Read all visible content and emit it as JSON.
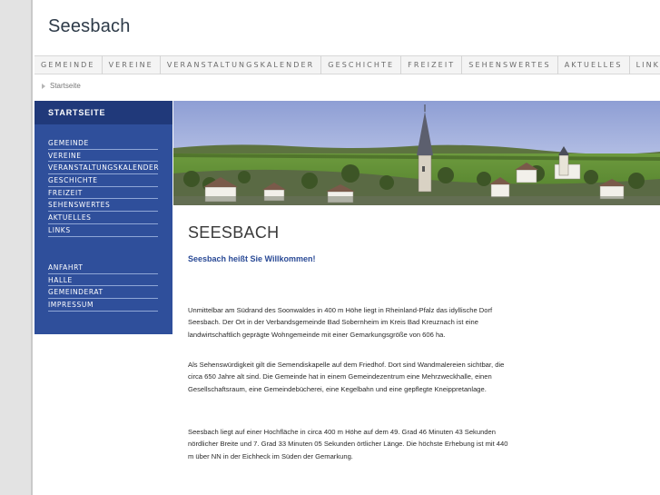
{
  "site": {
    "title": "Seesbach"
  },
  "topnav": {
    "items": [
      "GEMEINDE",
      "VEREINE",
      "VERANSTALTUNGSKALENDER",
      "GESCHICHTE",
      "FREIZEIT",
      "SEHENSWERTES",
      "AKTUELLES",
      "LINKS"
    ]
  },
  "breadcrumb": {
    "current": "Startseite"
  },
  "sidebar": {
    "heading": "STARTSEITE",
    "items": [
      "GEMEINDE",
      "VEREINE",
      "VERANSTALTUNGSKALENDER",
      "GESCHICHTE",
      "FREIZEIT",
      "SEHENSWERTES",
      "AKTUELLES",
      "LINKS"
    ],
    "items2": [
      "ANFAHRT",
      "HALLE",
      "GEMEINDERAT",
      "IMPRESSUM"
    ]
  },
  "main": {
    "heading": "SEESBACH",
    "welcome": "Seesbach heißt Sie Willkommen!",
    "paragraphs": [
      "Unmittelbar am Südrand des Soonwaldes in 400 m Höhe liegt in Rheinland-Pfalz das idyllische Dorf Seesbach. Der Ort in der Verbandsgemeinde Bad Sobernheim im Kreis Bad Kreuznach ist eine landwirtschaftlich geprägte Wohngemeinde mit einer Gemarkungsgröße von 606 ha.",
      "Als Sehenswürdigkeit gilt die Semendiskapelle auf dem Friedhof. Dort sind Wandmalereien sichtbar, die circa 650 Jahre alt sind. Die Gemeinde hat in einem Gemeindezentrum eine Mehrzweckhalle, einen Gesellschaftsraum, eine Gemeindebücherei, eine Kegelbahn und eine gepflegte Kneippretanlage.",
      "Seesbach liegt auf einer Hochfläche in circa 400 m Höhe auf dem 49. Grad 46 Minuten 43 Sekunden nördlicher Breite und 7. Grad 33 Minuten 05 Sekunden örtlicher Länge. Die höchste Erhebung ist mit 440 m über NN in der Eichheck im Süden der Gemarkung."
    ]
  },
  "colors": {
    "sidebar": "#2f4f9b",
    "sidebar_head": "#20397a",
    "welcome": "#2a4a96"
  }
}
